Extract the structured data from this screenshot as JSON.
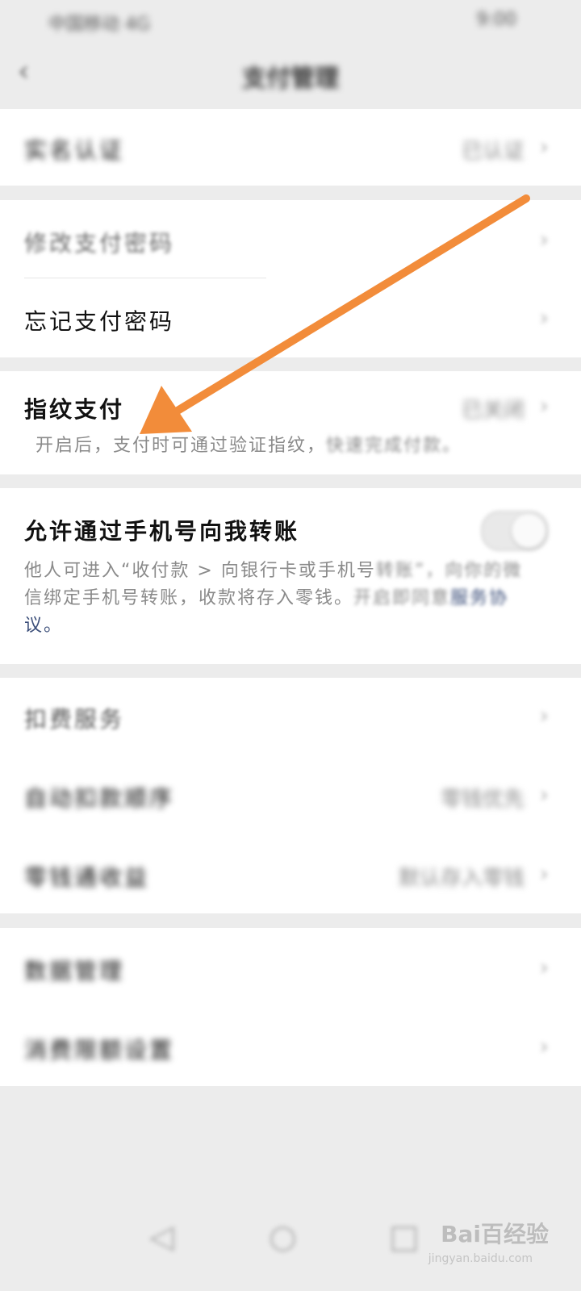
{
  "status_bar": {
    "left": "中国移动 4G",
    "right": "9:00"
  },
  "nav": {
    "title": "支付管理"
  },
  "rows": {
    "auth": {
      "label": "实名认证",
      "value": "已认证"
    },
    "change_password": {
      "label": "修改支付密码"
    },
    "forgot_password": {
      "label": "忘记支付密码"
    },
    "fingerprint": {
      "label": "指纹支付",
      "value": "已关闭",
      "desc_visible": "开启后，支付时可通过验证指纹，",
      "desc_blur": "快速完成付款。"
    },
    "phone_transfer": {
      "label": "允许通过手机号向我转账",
      "desc_line1_visible": "他人可进入“收付款 > 向银行卡或手机号",
      "desc_line1_blur": "转账”，向你的微",
      "desc_line2_visible": "信绑定手机号转账，收款将存入零钱。",
      "desc_line2_blur": "开启即同意",
      "desc_link": "服务协",
      "desc_line3": "议。"
    },
    "deduction": {
      "label": "扣费服务"
    },
    "deduction_order": {
      "label": "自动扣款顺序",
      "value": "零钱优先"
    },
    "balance": {
      "label": "零钱通收益",
      "value": "默认存入零钱"
    },
    "data_manage": {
      "label": "数据管理"
    },
    "spending_limit": {
      "label": "消费限额设置"
    }
  },
  "watermark": {
    "brand": "Bai百经验",
    "url": "jingyan.baidu.com"
  },
  "colors": {
    "arrow": "#f28c3a",
    "background": "#ececec",
    "card": "#ffffff"
  }
}
